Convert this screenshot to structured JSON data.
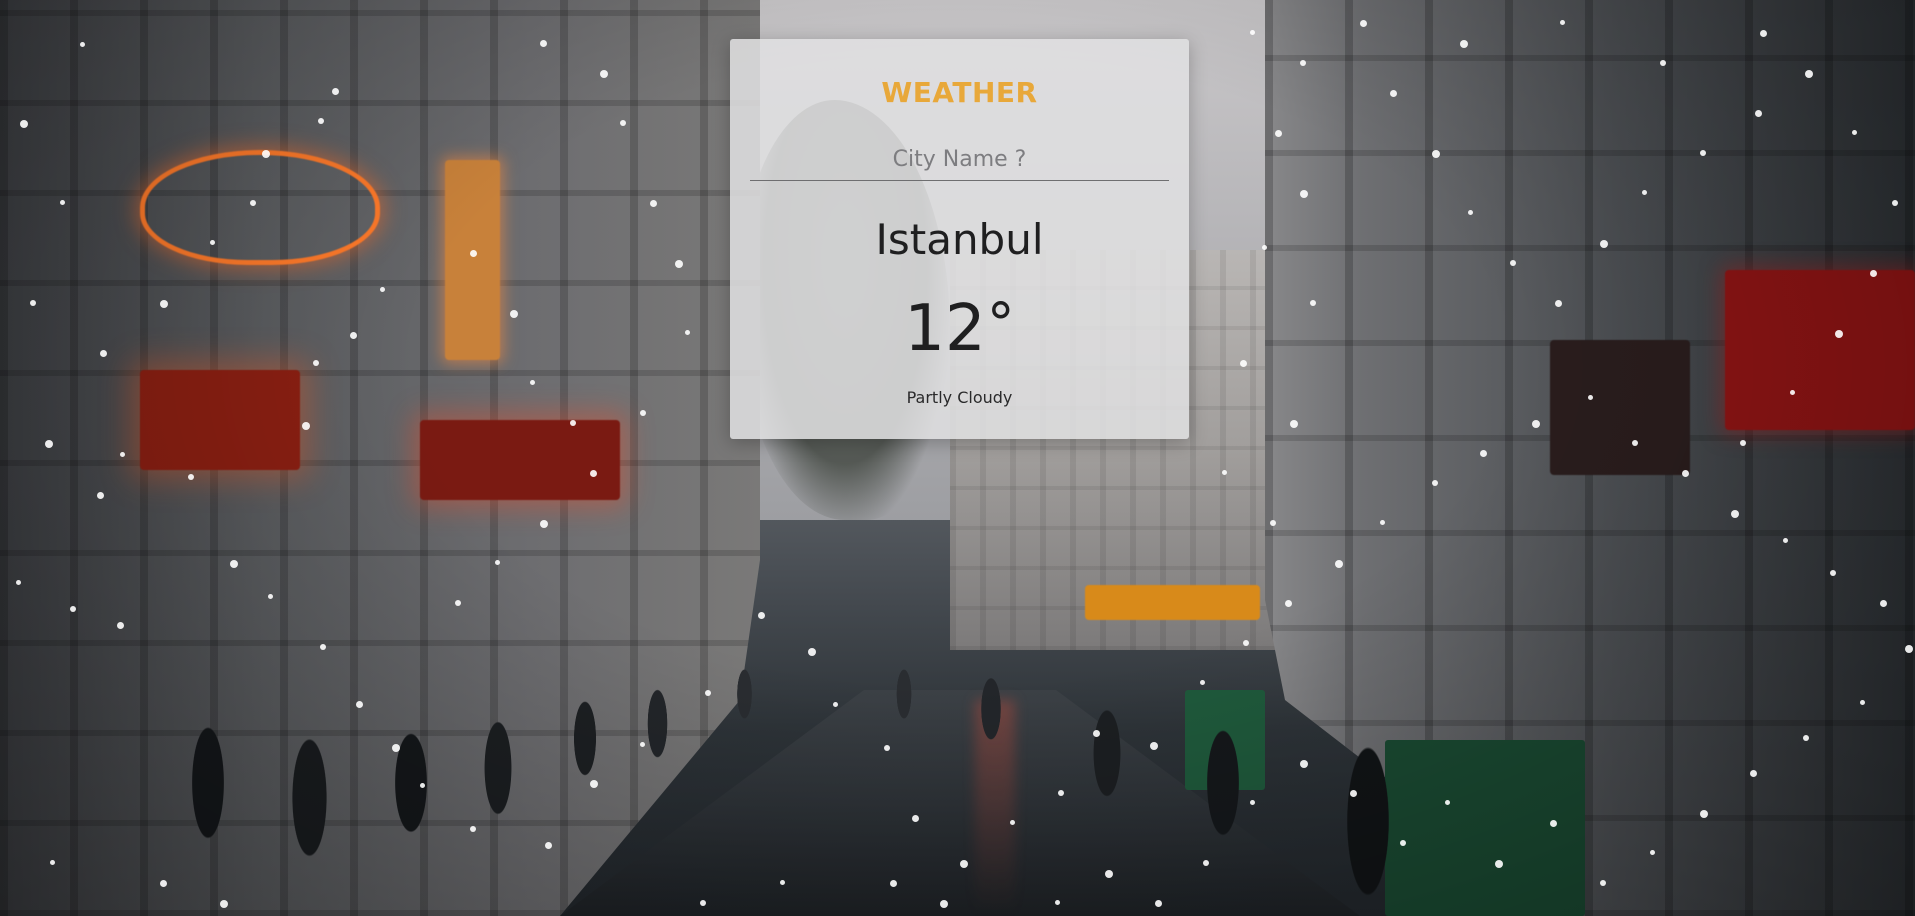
{
  "app": {
    "title": "WEATHER"
  },
  "search": {
    "placeholder": "City Name ?",
    "value": ""
  },
  "weather": {
    "city": "Istanbul",
    "temperature": "12",
    "unit": "°",
    "condition": "Partly Cloudy"
  },
  "background": {
    "scene": "rainy-city-street",
    "effect": "falling-snow"
  },
  "colors": {
    "title_accent": "#e8a83a",
    "card_background": "rgba(225,225,226,0.86)",
    "text_primary": "#1f1f20"
  }
}
